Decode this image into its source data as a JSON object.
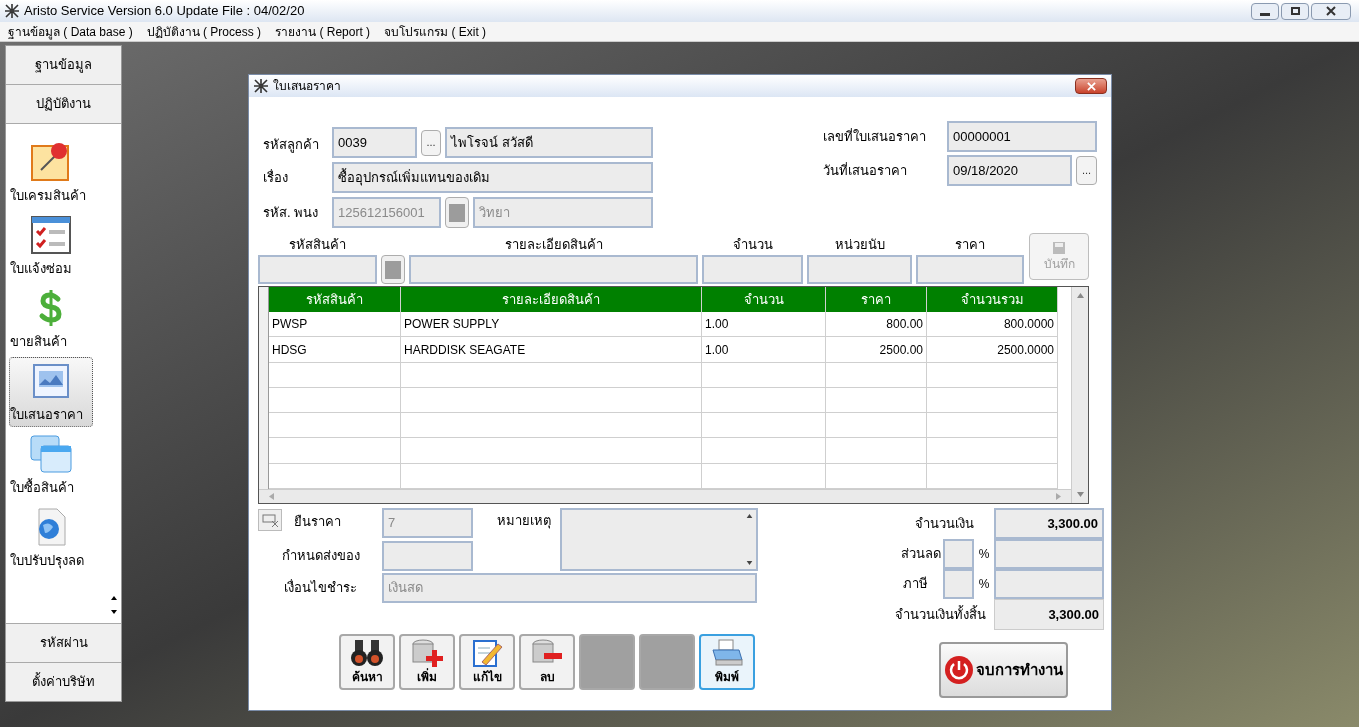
{
  "window": {
    "title": "Aristo Service Version 6.0 Update File : 04/02/20"
  },
  "menu": [
    "ฐานข้อมูล ( Data base )",
    "ปฏิบัติงาน ( Process )",
    "รายงาน ( Report )",
    "จบโปรแกรม ( Exit )"
  ],
  "sidebar": {
    "top_buttons": [
      "ฐานข้อมูล",
      "ปฏิบัติงาน"
    ],
    "items": [
      {
        "label": "ใบเครมสินค้า",
        "selected": false
      },
      {
        "label": "ใบแจ้งซ่อม",
        "selected": false
      },
      {
        "label": "ขายสินค้า",
        "selected": false
      },
      {
        "label": "ใบเสนอราคา",
        "selected": true
      },
      {
        "label": "ใบซื้อสินค้า",
        "selected": false
      },
      {
        "label": "ใบปรับปรุงลด",
        "selected": false
      }
    ],
    "bottom_buttons": [
      "รหัสผ่าน",
      "ตั้งค่าบริษัท"
    ]
  },
  "dialog": {
    "title": "ใบเสนอราคา",
    "customer": {
      "label": "รหัสลูกค้า",
      "code": "0039",
      "browse": "...",
      "name": "ไพโรจน์ สวัสดี"
    },
    "subject": {
      "label": "เรื่อง",
      "value": "ซื้ออุปกรณ์เพิ่มแทนของเดิม"
    },
    "employee": {
      "label": "รหัส. พนง",
      "code": "125612156001",
      "name": "วิทยา",
      "disabled": true
    },
    "quote_no": {
      "label": "เลขที่ใบเสนอราคา",
      "value": "00000001"
    },
    "quote_date": {
      "label": "วันที่เสนอราคา",
      "value": "09/18/2020",
      "browse": "..."
    },
    "entry": {
      "labels": [
        "รหัสสินค้า",
        "รายละเอียดสินค้า",
        "จำนวน",
        "หน่วยนับ",
        "ราคา"
      ],
      "save_button": {
        "label": "บันทึก",
        "disabled": true
      }
    },
    "table": {
      "columns": [
        "รหัสสินค้า",
        "รายละเอียดสินค้า",
        "จำนวน",
        "ราคา",
        "จำนวนรวม"
      ],
      "rows": [
        [
          "PWSP",
          "POWER SUPPLY",
          "1.00",
          "800.00",
          "800.0000"
        ],
        [
          "HDSG",
          "HARDDISK SEAGATE",
          "1.00",
          "2500.00",
          "2500.0000"
        ]
      ]
    },
    "validity": {
      "label": "ยืนราคา",
      "value": "7",
      "disabled": true
    },
    "delivery": {
      "label": "กำหนดส่งของ"
    },
    "payment": {
      "label": "เงื่อนไขชำระ",
      "value": "เงินสด",
      "disabled": true
    },
    "remark": {
      "label": "หมายเหตุ"
    },
    "amount": {
      "label": "จำนวนเงิน",
      "value": "3,300.00"
    },
    "discount": {
      "label": "ส่วนลด",
      "unit": "%"
    },
    "tax": {
      "label": "ภาษี",
      "unit": "%"
    },
    "total": {
      "label": "จำนวนเงินทั้งสิ้น",
      "value": "3,300.00"
    },
    "toolbar": [
      {
        "kind": "search",
        "label": "ค้นหา",
        "selected": false
      },
      {
        "kind": "add",
        "label": "เพิ่ม",
        "selected": false
      },
      {
        "kind": "edit",
        "label": "แก้ไข",
        "selected": false
      },
      {
        "kind": "delete",
        "label": "ลบ",
        "selected": false
      },
      {
        "kind": "blank",
        "selected": false
      },
      {
        "kind": "blank",
        "selected": false
      },
      {
        "kind": "print",
        "label": "พิมพ์",
        "selected": true
      }
    ],
    "exit_button": "จบการทำงาน"
  }
}
